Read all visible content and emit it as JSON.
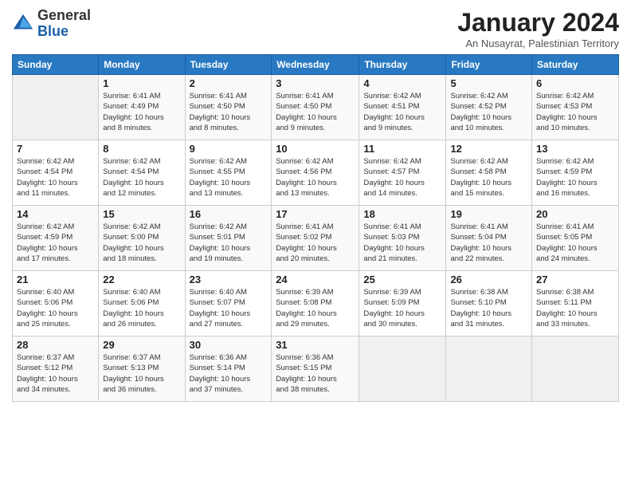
{
  "logo": {
    "general": "General",
    "blue": "Blue"
  },
  "header": {
    "month": "January 2024",
    "location": "An Nusayrat, Palestinian Territory"
  },
  "days_of_week": [
    "Sunday",
    "Monday",
    "Tuesday",
    "Wednesday",
    "Thursday",
    "Friday",
    "Saturday"
  ],
  "weeks": [
    [
      {
        "day": "",
        "info": ""
      },
      {
        "day": "1",
        "info": "Sunrise: 6:41 AM\nSunset: 4:49 PM\nDaylight: 10 hours\nand 8 minutes."
      },
      {
        "day": "2",
        "info": "Sunrise: 6:41 AM\nSunset: 4:50 PM\nDaylight: 10 hours\nand 8 minutes."
      },
      {
        "day": "3",
        "info": "Sunrise: 6:41 AM\nSunset: 4:50 PM\nDaylight: 10 hours\nand 9 minutes."
      },
      {
        "day": "4",
        "info": "Sunrise: 6:42 AM\nSunset: 4:51 PM\nDaylight: 10 hours\nand 9 minutes."
      },
      {
        "day": "5",
        "info": "Sunrise: 6:42 AM\nSunset: 4:52 PM\nDaylight: 10 hours\nand 10 minutes."
      },
      {
        "day": "6",
        "info": "Sunrise: 6:42 AM\nSunset: 4:53 PM\nDaylight: 10 hours\nand 10 minutes."
      }
    ],
    [
      {
        "day": "7",
        "info": "Sunrise: 6:42 AM\nSunset: 4:54 PM\nDaylight: 10 hours\nand 11 minutes."
      },
      {
        "day": "8",
        "info": "Sunrise: 6:42 AM\nSunset: 4:54 PM\nDaylight: 10 hours\nand 12 minutes."
      },
      {
        "day": "9",
        "info": "Sunrise: 6:42 AM\nSunset: 4:55 PM\nDaylight: 10 hours\nand 13 minutes."
      },
      {
        "day": "10",
        "info": "Sunrise: 6:42 AM\nSunset: 4:56 PM\nDaylight: 10 hours\nand 13 minutes."
      },
      {
        "day": "11",
        "info": "Sunrise: 6:42 AM\nSunset: 4:57 PM\nDaylight: 10 hours\nand 14 minutes."
      },
      {
        "day": "12",
        "info": "Sunrise: 6:42 AM\nSunset: 4:58 PM\nDaylight: 10 hours\nand 15 minutes."
      },
      {
        "day": "13",
        "info": "Sunrise: 6:42 AM\nSunset: 4:59 PM\nDaylight: 10 hours\nand 16 minutes."
      }
    ],
    [
      {
        "day": "14",
        "info": "Sunrise: 6:42 AM\nSunset: 4:59 PM\nDaylight: 10 hours\nand 17 minutes."
      },
      {
        "day": "15",
        "info": "Sunrise: 6:42 AM\nSunset: 5:00 PM\nDaylight: 10 hours\nand 18 minutes."
      },
      {
        "day": "16",
        "info": "Sunrise: 6:42 AM\nSunset: 5:01 PM\nDaylight: 10 hours\nand 19 minutes."
      },
      {
        "day": "17",
        "info": "Sunrise: 6:41 AM\nSunset: 5:02 PM\nDaylight: 10 hours\nand 20 minutes."
      },
      {
        "day": "18",
        "info": "Sunrise: 6:41 AM\nSunset: 5:03 PM\nDaylight: 10 hours\nand 21 minutes."
      },
      {
        "day": "19",
        "info": "Sunrise: 6:41 AM\nSunset: 5:04 PM\nDaylight: 10 hours\nand 22 minutes."
      },
      {
        "day": "20",
        "info": "Sunrise: 6:41 AM\nSunset: 5:05 PM\nDaylight: 10 hours\nand 24 minutes."
      }
    ],
    [
      {
        "day": "21",
        "info": "Sunrise: 6:40 AM\nSunset: 5:06 PM\nDaylight: 10 hours\nand 25 minutes."
      },
      {
        "day": "22",
        "info": "Sunrise: 6:40 AM\nSunset: 5:06 PM\nDaylight: 10 hours\nand 26 minutes."
      },
      {
        "day": "23",
        "info": "Sunrise: 6:40 AM\nSunset: 5:07 PM\nDaylight: 10 hours\nand 27 minutes."
      },
      {
        "day": "24",
        "info": "Sunrise: 6:39 AM\nSunset: 5:08 PM\nDaylight: 10 hours\nand 29 minutes."
      },
      {
        "day": "25",
        "info": "Sunrise: 6:39 AM\nSunset: 5:09 PM\nDaylight: 10 hours\nand 30 minutes."
      },
      {
        "day": "26",
        "info": "Sunrise: 6:38 AM\nSunset: 5:10 PM\nDaylight: 10 hours\nand 31 minutes."
      },
      {
        "day": "27",
        "info": "Sunrise: 6:38 AM\nSunset: 5:11 PM\nDaylight: 10 hours\nand 33 minutes."
      }
    ],
    [
      {
        "day": "28",
        "info": "Sunrise: 6:37 AM\nSunset: 5:12 PM\nDaylight: 10 hours\nand 34 minutes."
      },
      {
        "day": "29",
        "info": "Sunrise: 6:37 AM\nSunset: 5:13 PM\nDaylight: 10 hours\nand 36 minutes."
      },
      {
        "day": "30",
        "info": "Sunrise: 6:36 AM\nSunset: 5:14 PM\nDaylight: 10 hours\nand 37 minutes."
      },
      {
        "day": "31",
        "info": "Sunrise: 6:36 AM\nSunset: 5:15 PM\nDaylight: 10 hours\nand 38 minutes."
      },
      {
        "day": "",
        "info": ""
      },
      {
        "day": "",
        "info": ""
      },
      {
        "day": "",
        "info": ""
      }
    ]
  ]
}
